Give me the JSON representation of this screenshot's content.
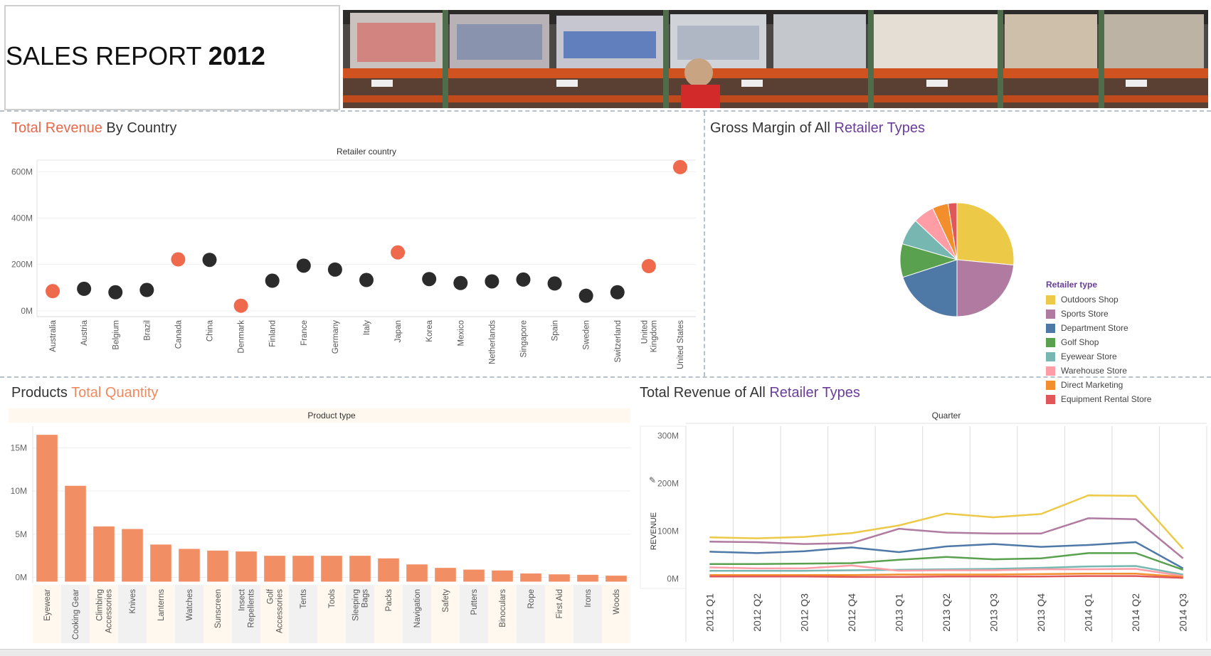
{
  "header": {
    "title_main": "SALES REPORT",
    "title_year": "2012",
    "banner_image": "warehouse-shelves-photo"
  },
  "colors": {
    "accent_orange": "#ef6a4c",
    "dark_point": "#2b2b2b",
    "bar_salmon": "#f28e64",
    "purple": "#6a3d9a"
  },
  "sections": {
    "revenue_country": {
      "a": "Total Revenue",
      "b": " By Country"
    },
    "gross_margin": {
      "a": "Gross Margin",
      "b": " of All ",
      "c": "Retailer Types"
    },
    "products_qty": {
      "a": "Products ",
      "b": "Total Quantity"
    },
    "revenue_retailer": {
      "a": "Total Revenue",
      "b": " of All ",
      "c": "Retailer Types"
    }
  },
  "chart_data": [
    {
      "type": "scatter",
      "id": "revenue_by_country",
      "column_header": "Retailer country",
      "categories": [
        "Australia",
        "Austria",
        "Belgium",
        "Brazil",
        "Canada",
        "China",
        "Denmark",
        "Finland",
        "France",
        "Germany",
        "Italy",
        "Japan",
        "Korea",
        "Mexico",
        "Netherlands",
        "Singapore",
        "Spain",
        "Sweden",
        "Switzerland",
        "United Kingdom",
        "United States"
      ],
      "category_labels": [
        [
          "Australia"
        ],
        [
          "Austria"
        ],
        [
          "Belgium"
        ],
        [
          "Brazil"
        ],
        [
          "Canada"
        ],
        [
          "China"
        ],
        [
          "Denmark"
        ],
        [
          "Finland"
        ],
        [
          "France"
        ],
        [
          "Germany"
        ],
        [
          "Italy"
        ],
        [
          "Japan"
        ],
        [
          "Korea"
        ],
        [
          "Mexico"
        ],
        [
          "Netherlands"
        ],
        [
          "Singapore"
        ],
        [
          "Spain"
        ],
        [
          "Sweden"
        ],
        [
          "Switzerland"
        ],
        [
          "United",
          "Kingdom"
        ],
        [
          "United States"
        ]
      ],
      "values": [
        85,
        95,
        80,
        90,
        222,
        220,
        22,
        130,
        195,
        178,
        133,
        252,
        137,
        120,
        127,
        135,
        118,
        65,
        80,
        193,
        620
      ],
      "highlighted": [
        true,
        false,
        false,
        false,
        true,
        false,
        true,
        false,
        false,
        false,
        false,
        true,
        false,
        false,
        false,
        false,
        false,
        false,
        false,
        true,
        true
      ],
      "yticks": [
        0,
        200,
        400,
        600
      ],
      "ytick_labels": [
        "0M",
        "200M",
        "400M",
        "600M"
      ],
      "ylim": [
        -25,
        675
      ],
      "unit": "M"
    },
    {
      "type": "pie",
      "id": "gross_margin_retailer",
      "legend_title": "Retailer type",
      "slices": [
        {
          "name": "Outdoors Shop",
          "value": 26.5,
          "color": "#edc948"
        },
        {
          "name": "Sports Store",
          "value": 23.5,
          "color": "#b07aa1"
        },
        {
          "name": "Department Store",
          "value": 20.0,
          "color": "#4e79a7"
        },
        {
          "name": "Golf Shop",
          "value": 9.5,
          "color": "#59a14f"
        },
        {
          "name": "Eyewear Store",
          "value": 7.5,
          "color": "#76b7b2"
        },
        {
          "name": "Warehouse Store",
          "value": 6.0,
          "color": "#ff9da7"
        },
        {
          "name": "Direct Marketing",
          "value": 4.5,
          "color": "#f28e2b"
        },
        {
          "name": "Equipment Rental Store",
          "value": 2.5,
          "color": "#e15759"
        }
      ]
    },
    {
      "type": "bar",
      "id": "products_total_quantity",
      "column_header": "Product type",
      "categories": [
        "Eyewear",
        "Cooking Gear",
        "Climbing Accessories",
        "Knives",
        "Lanterns",
        "Watches",
        "Sunscreen",
        "Insect Repellents",
        "Golf Accessories",
        "Tents",
        "Tools",
        "Sleeping Bags",
        "Packs",
        "Navigation",
        "Safety",
        "Putters",
        "Binoculars",
        "Rope",
        "First Aid",
        "Irons",
        "Woods"
      ],
      "category_labels": [
        [
          "Eyewear"
        ],
        [
          "Cooking Gear"
        ],
        [
          "Climbing",
          "Accessories"
        ],
        [
          "Knives"
        ],
        [
          "Lanterns"
        ],
        [
          "Watches"
        ],
        [
          "Sunscreen"
        ],
        [
          "Insect",
          "Repellents"
        ],
        [
          "Golf",
          "Accessories"
        ],
        [
          "Tents"
        ],
        [
          "Tools"
        ],
        [
          "Sleeping",
          "Bags"
        ],
        [
          "Packs"
        ],
        [
          "Navigation"
        ],
        [
          "Safety"
        ],
        [
          "Putters"
        ],
        [
          "Binoculars"
        ],
        [
          "Rope"
        ],
        [
          "First Aid"
        ],
        [
          "Irons"
        ],
        [
          "Woods"
        ]
      ],
      "values": [
        16.5,
        10.6,
        5.9,
        5.6,
        3.8,
        3.3,
        3.1,
        3.0,
        2.5,
        2.5,
        2.5,
        2.5,
        2.2,
        1.5,
        1.1,
        0.9,
        0.8,
        0.45,
        0.35,
        0.3,
        0.2
      ],
      "yticks": [
        0,
        5,
        10,
        15
      ],
      "ytick_labels": [
        "0M",
        "5M",
        "10M",
        "15M"
      ],
      "ylim": [
        -0.7,
        17.5
      ],
      "unit": "M"
    },
    {
      "type": "line",
      "id": "revenue_by_retailer_quarter",
      "column_header": "Quarter",
      "ylabel": "REVENUE",
      "categories": [
        "2012 Q1",
        "2012 Q2",
        "2012 Q3",
        "2012 Q4",
        "2013 Q1",
        "2013 Q2",
        "2013 Q3",
        "2013 Q4",
        "2014 Q1",
        "2014 Q2",
        "2014 Q3"
      ],
      "yticks": [
        0,
        100,
        200,
        300
      ],
      "ytick_labels": [
        "0M",
        "100M",
        "200M",
        "300M"
      ],
      "ylim": [
        -20,
        320
      ],
      "series": [
        {
          "name": "Outdoors Shop",
          "color": "#edc948",
          "values": [
            87,
            85,
            88,
            96,
            112,
            137,
            129,
            136,
            175,
            174,
            63
          ]
        },
        {
          "name": "Sports Store",
          "color": "#b07aa1",
          "values": [
            78,
            77,
            73,
            75,
            105,
            97,
            95,
            95,
            127,
            125,
            43
          ]
        },
        {
          "name": "Department Store",
          "color": "#4e79a7",
          "values": [
            57,
            54,
            58,
            66,
            56,
            68,
            73,
            67,
            71,
            77,
            22
          ]
        },
        {
          "name": "Golf Shop",
          "color": "#59a14f",
          "values": [
            31,
            31,
            32,
            33,
            40,
            46,
            41,
            43,
            54,
            54,
            19
          ]
        },
        {
          "name": "Eyewear Store",
          "color": "#76b7b2",
          "values": [
            17,
            17,
            17,
            18,
            19,
            20,
            21,
            23,
            26,
            27,
            9
          ]
        },
        {
          "name": "Warehouse Store",
          "color": "#ff9da7",
          "values": [
            24,
            22,
            22,
            28,
            17,
            18,
            18,
            20,
            20,
            21,
            6
          ]
        },
        {
          "name": "Direct Marketing",
          "color": "#f28e2b",
          "values": [
            8,
            8,
            8,
            8,
            9,
            9,
            9,
            10,
            11,
            11,
            4
          ]
        },
        {
          "name": "Equipment Rental Store",
          "color": "#e15759",
          "values": [
            5,
            5,
            5,
            4,
            4,
            5,
            5,
            5,
            6,
            6,
            2
          ]
        }
      ]
    }
  ]
}
